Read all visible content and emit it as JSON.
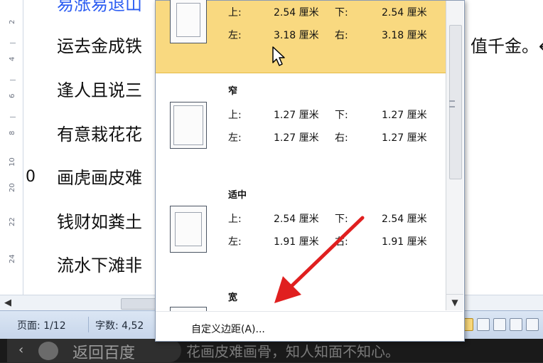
{
  "document": {
    "lines": [
      "易涨易退山",
      "运去金成铁",
      "逢人且说三",
      "有意栽花花",
      "画虎画皮难",
      "钱财如粪土",
      "流水下滩非"
    ],
    "right_fragment": "值千金。↵",
    "ruler_numbers": [
      "2",
      "4",
      "6",
      "8",
      "10",
      "20",
      "22",
      "24"
    ],
    "left_marker": "0"
  },
  "statusbar": {
    "page": "页面: 1/12",
    "words": "字数: 4,52"
  },
  "dropdown": {
    "items": [
      {
        "name": "",
        "top_label": "上:",
        "top_value": "2.54 厘米",
        "bottom_label": "下:",
        "bottom_value": "2.54 厘米",
        "left_label": "左:",
        "left_value": "3.18 厘米",
        "right_label": "右:",
        "right_value": "3.18 厘米",
        "highlighted": true
      },
      {
        "name": "窄",
        "top_label": "上:",
        "top_value": "1.27 厘米",
        "bottom_label": "下:",
        "bottom_value": "1.27 厘米",
        "left_label": "左:",
        "left_value": "1.27 厘米",
        "right_label": "右:",
        "right_value": "1.27 厘米",
        "highlighted": false
      },
      {
        "name": "适中",
        "top_label": "上:",
        "top_value": "2.54 厘米",
        "bottom_label": "下:",
        "bottom_value": "2.54 厘米",
        "left_label": "左:",
        "left_value": "1.91 厘米",
        "right_label": "右:",
        "right_value": "1.91 厘米",
        "highlighted": false
      },
      {
        "name": "宽",
        "highlighted": false
      }
    ],
    "custom_label": "自定义边距(A)..."
  },
  "bottom_bar": {
    "baidu_text": "返回百度",
    "fragment": "花画皮难画骨，知人知面不知心。"
  },
  "colors": {
    "highlight": "#f9d980",
    "annotation_arrow": "#e01f1f",
    "statusbar": "#c6d5ea",
    "link_text": "#2b5cf2"
  }
}
